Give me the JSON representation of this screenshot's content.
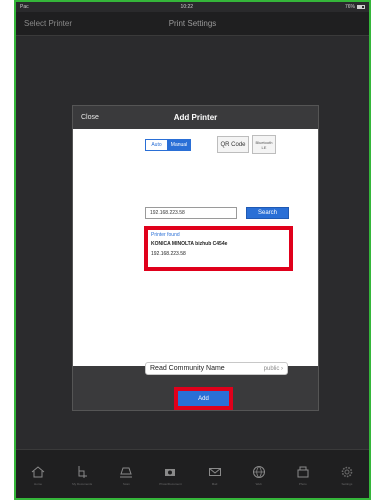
{
  "status": {
    "carrier": "Pac",
    "time": "10:22",
    "battery": "76%"
  },
  "nav": {
    "back": "Select Printer",
    "title": "Print Settings"
  },
  "dialog": {
    "close": "Close",
    "title": "Add Printer",
    "mode_auto": "Auto",
    "mode_manual": "Manual",
    "qr_code": "QR Code",
    "bluetooth_line1": "Bluetooth",
    "bluetooth_line2": "LE",
    "ip_value": "192.168.223.58",
    "search": "Search",
    "found_label": "Printer found",
    "found_name": "KONICA MINOLTA bizhub C454e",
    "found_ip": "192.168.223.58",
    "community_label": "Read Community Name",
    "community_value": "public",
    "add": "Add"
  },
  "tabs": [
    {
      "label": "Home",
      "icon": "home-icon"
    },
    {
      "label": "My Documents",
      "icon": "documents-icon"
    },
    {
      "label": "Scan",
      "icon": "scan-icon"
    },
    {
      "label": "Photo/Document",
      "icon": "camera-icon"
    },
    {
      "label": "Mail",
      "icon": "mail-icon"
    },
    {
      "label": "Web",
      "icon": "globe-icon"
    },
    {
      "label": "Photo",
      "icon": "photo-icon"
    },
    {
      "label": "Settings",
      "icon": "gear-icon"
    }
  ],
  "colors": {
    "accent": "#2a6fd6",
    "highlight": "#e0001b",
    "frame": "#35b63a"
  }
}
